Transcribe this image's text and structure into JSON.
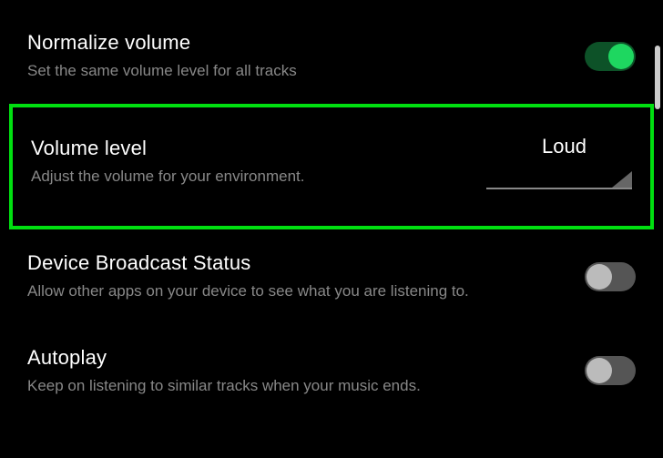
{
  "settings": {
    "normalize": {
      "title": "Normalize volume",
      "description": "Set the same volume level for all tracks",
      "enabled": true
    },
    "volumeLevel": {
      "title": "Volume level",
      "description": "Adjust the volume for your environment.",
      "value": "Loud"
    },
    "broadcast": {
      "title": "Device Broadcast Status",
      "description": "Allow other apps on your device to see what you are listening to.",
      "enabled": false
    },
    "autoplay": {
      "title": "Autoplay",
      "description": "Keep on listening to similar tracks when your music ends.",
      "enabled": false
    }
  }
}
